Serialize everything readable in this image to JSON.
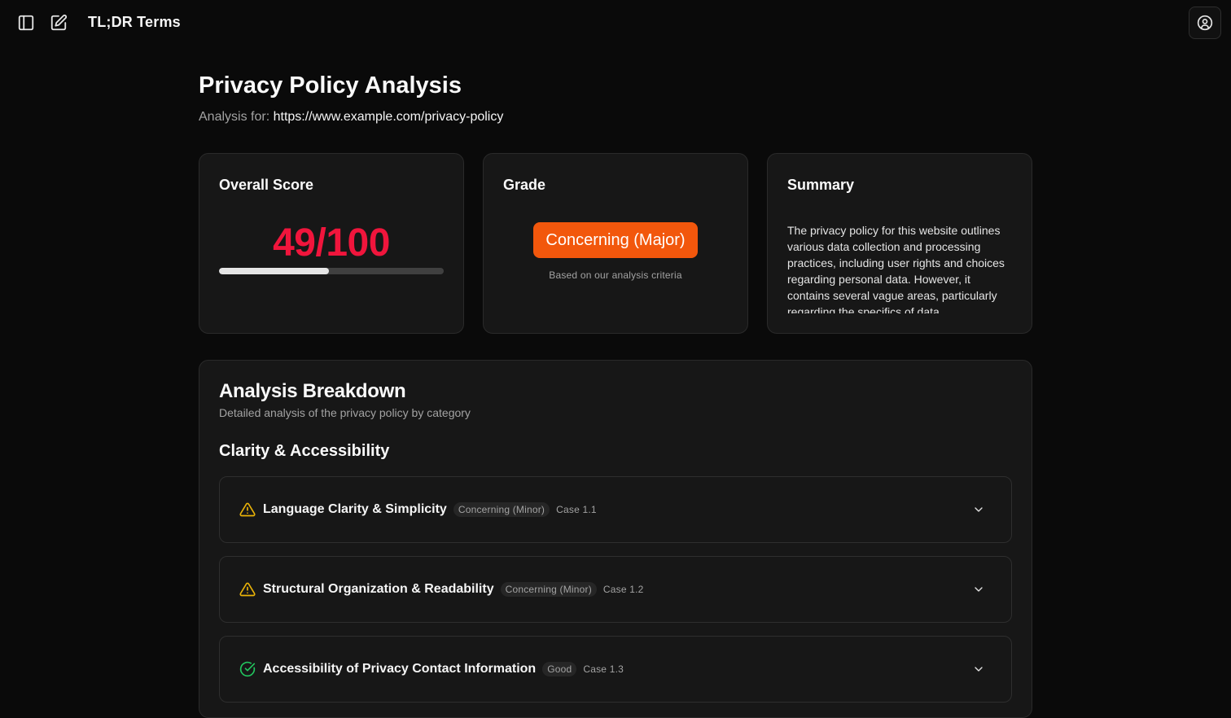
{
  "app": {
    "title": "TL;DR Terms"
  },
  "toolbar": {
    "sidebar_icon": "sidebar-toggle-icon",
    "new_icon": "edit-icon",
    "user_icon": "user-circle-icon"
  },
  "page": {
    "title": "Privacy Policy Analysis",
    "analysis_for_label": "Analysis for:",
    "analysis_url": "https://www.example.com/privacy-policy"
  },
  "score_card": {
    "title": "Overall Score",
    "value": "49/100",
    "progress": 0.49,
    "color": "#f0153c"
  },
  "grade_card": {
    "title": "Grade",
    "grade": "Concerning (Major)",
    "note": "Based on our analysis criteria",
    "color": "#f2570c"
  },
  "summary_card": {
    "title": "Summary",
    "text": "The privacy policy for this website outlines various data collection and processing practices, including user rights and choices regarding personal data. However, it contains several vague areas, particularly regarding the specifics of data"
  },
  "breakdown": {
    "title": "Analysis Breakdown",
    "subtitle": "Detailed analysis of the privacy policy by category",
    "section_title": "Clarity & Accessibility",
    "items": [
      {
        "title": "Language Clarity & Simplicity",
        "status": "Concerning (Minor)",
        "case": "Case 1.1",
        "icon": "warning-icon"
      },
      {
        "title": "Structural Organization & Readability",
        "status": "Concerning (Minor)",
        "case": "Case 1.2",
        "icon": "warning-icon"
      },
      {
        "title": "Accessibility of Privacy Contact Information",
        "status": "Good",
        "case": "Case 1.3",
        "icon": "check-circle-icon"
      }
    ]
  },
  "colors": {
    "warning": "#eab308",
    "good": "#22c55e"
  }
}
